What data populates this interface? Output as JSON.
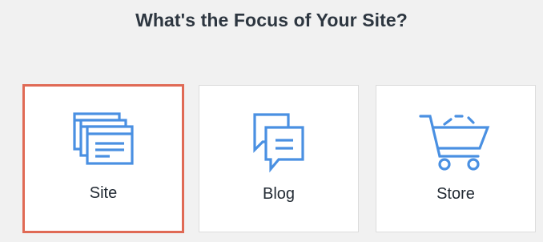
{
  "heading": "What's the Focus of Your Site?",
  "options": [
    {
      "label": "Site",
      "icon": "site-windows-icon",
      "selected": true
    },
    {
      "label": "Blog",
      "icon": "blog-chat-icon",
      "selected": false
    },
    {
      "label": "Store",
      "icon": "shopping-cart-icon",
      "selected": false
    }
  ],
  "colors": {
    "background": "#f1f1f1",
    "icon_blue": "#4a90e2",
    "selected_border": "#e06a55",
    "heading_text": "#2d3640"
  }
}
